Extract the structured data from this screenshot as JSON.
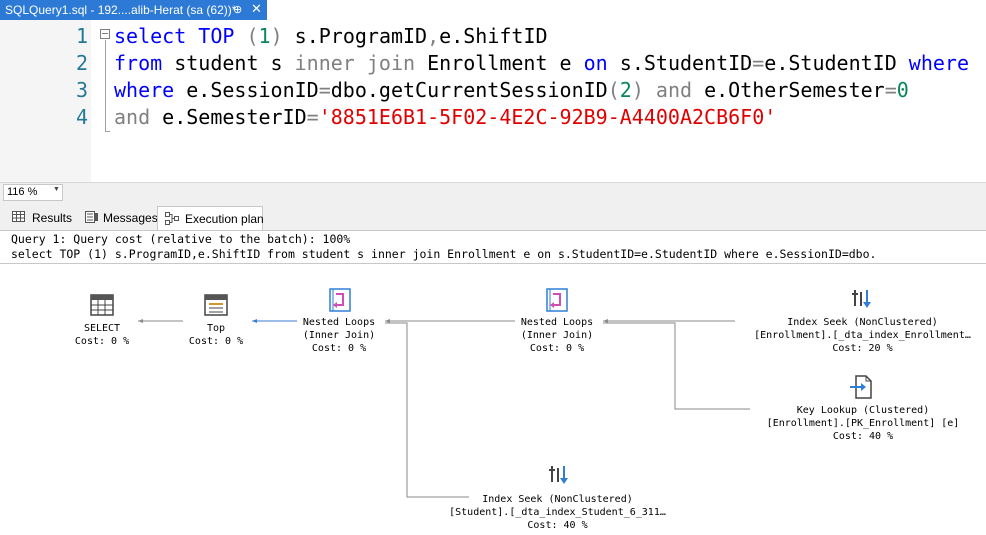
{
  "document_tab": {
    "title": "SQLQuery1.sql - 192....alib-Herat (sa (62))*",
    "pin_glyph": "⊕",
    "close_glyph": "✕"
  },
  "editor": {
    "line_numbers": [
      "1",
      "2",
      "3",
      "4"
    ],
    "lines": [
      [
        {
          "t": "select",
          "c": "kw"
        },
        {
          "t": " ",
          "c": ""
        },
        {
          "t": "TOP",
          "c": "kw"
        },
        {
          "t": " ",
          "c": ""
        },
        {
          "t": "(",
          "c": "gray"
        },
        {
          "t": "1",
          "c": "num"
        },
        {
          "t": ")",
          "c": "gray"
        },
        {
          "t": " s.ProgramID",
          "c": ""
        },
        {
          "t": ",",
          "c": "gray"
        },
        {
          "t": "e.ShiftID",
          "c": ""
        }
      ],
      [
        {
          "t": "from",
          "c": "kw"
        },
        {
          "t": " student s ",
          "c": ""
        },
        {
          "t": "inner",
          "c": "gray"
        },
        {
          "t": " ",
          "c": ""
        },
        {
          "t": "join",
          "c": "gray"
        },
        {
          "t": " Enrollment e ",
          "c": ""
        },
        {
          "t": "on",
          "c": "kw"
        },
        {
          "t": " s.StudentID",
          "c": ""
        },
        {
          "t": "=",
          "c": "gray"
        },
        {
          "t": "e.StudentID ",
          "c": ""
        },
        {
          "t": "where",
          "c": "kw"
        }
      ],
      [
        {
          "t": "where",
          "c": "kw"
        },
        {
          "t": " e.SessionID",
          "c": ""
        },
        {
          "t": "=",
          "c": "gray"
        },
        {
          "t": "dbo.getCurrentSessionID",
          "c": ""
        },
        {
          "t": "(",
          "c": "gray"
        },
        {
          "t": "2",
          "c": "num"
        },
        {
          "t": ")",
          "c": "gray"
        },
        {
          "t": " ",
          "c": ""
        },
        {
          "t": "and",
          "c": "gray"
        },
        {
          "t": " e.OtherSemester",
          "c": ""
        },
        {
          "t": "=",
          "c": "gray"
        },
        {
          "t": "0",
          "c": "num"
        }
      ],
      [
        {
          "t": "and",
          "c": "gray"
        },
        {
          "t": " e.SemesterID",
          "c": ""
        },
        {
          "t": "=",
          "c": "gray"
        },
        {
          "t": "'8851E6B1-5F02-4E2C-92B9-A4400A2CB6F0'",
          "c": "str"
        }
      ]
    ]
  },
  "zoom": {
    "value": "116 %"
  },
  "result_tabs": [
    {
      "label": "Results",
      "icon": "grid-icon",
      "active": false
    },
    {
      "label": "Messages",
      "icon": "messages-icon",
      "active": false
    },
    {
      "label": "Execution plan",
      "icon": "execution-plan-icon",
      "active": true
    }
  ],
  "plan": {
    "query_line": "Query 1: Query cost (relative to the batch): 100%",
    "sql_line": "select TOP (1) s.ProgramID,e.ShiftID from student s inner join Enrollment e on s.StudentID=e.StudentID where e.SessionID=dbo.",
    "nodes": {
      "select": {
        "icon": "select-icon",
        "lines": [
          "SELECT",
          "Cost: 0 %"
        ]
      },
      "top": {
        "icon": "top-icon",
        "lines": [
          "Top",
          "Cost: 0 %"
        ]
      },
      "nested_loops_1": {
        "icon": "nested-loops-icon",
        "lines": [
          "Nested Loops",
          "(Inner Join)",
          "Cost: 0 %"
        ]
      },
      "nested_loops_2": {
        "icon": "nested-loops-icon",
        "lines": [
          "Nested Loops",
          "(Inner Join)",
          "Cost: 0 %"
        ]
      },
      "index_seek_enrollment": {
        "icon": "index-seek-icon",
        "lines": [
          "Index Seek (NonClustered)",
          "[Enrollment].[_dta_index_Enrollment…",
          "Cost: 20 %"
        ]
      },
      "key_lookup": {
        "icon": "key-lookup-icon",
        "lines": [
          "Key Lookup (Clustered)",
          "[Enrollment].[PK_Enrollment] [e]",
          "Cost: 40 %"
        ]
      },
      "index_seek_student": {
        "icon": "index-seek-icon",
        "lines": [
          "Index Seek (NonClustered)",
          "[Student].[_dta_index_Student_6_311…",
          "Cost: 40 %"
        ]
      }
    }
  },
  "colors": {
    "tab_active": "#2d7ad6",
    "keyword": "#0000ff",
    "string": "#e00000",
    "operator": "#808080",
    "line_number": "#237893",
    "number": "#098658"
  }
}
